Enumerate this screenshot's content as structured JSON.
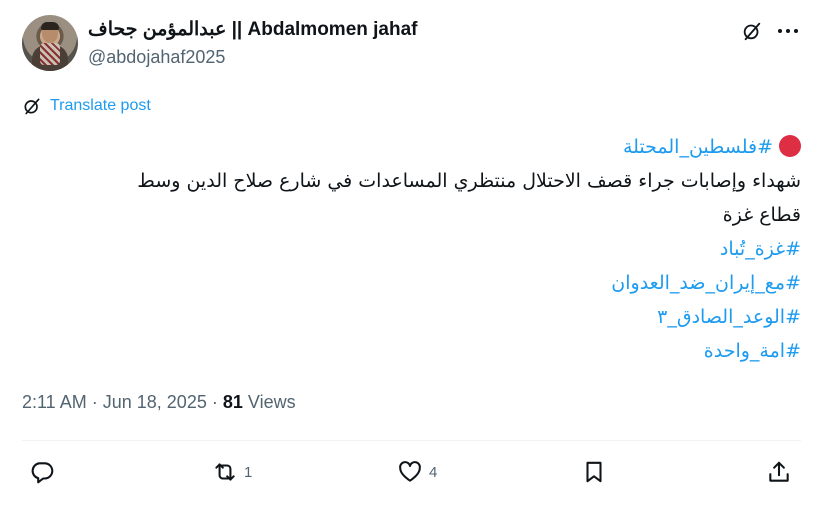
{
  "author": {
    "display_name": "عبدالمؤمن جحاف || Abdalmomen jahaf",
    "handle": "@abdojahaf2025"
  },
  "translate": {
    "label": "Translate post"
  },
  "tweet": {
    "lines": [
      {
        "text": "#فلسطين_المحتلة",
        "kind": "hashtag",
        "prefix": "red-circle"
      },
      {
        "text": "شهداء وإصابات جراء قصف الاحتلال منتظري المساعدات في شارع صلاح الدين وسط",
        "kind": "text"
      },
      {
        "text": "قطاع غزة",
        "kind": "text"
      },
      {
        "text": "#غزة_تُباد",
        "kind": "hashtag"
      },
      {
        "text": "#مع_إيران_ضد_العدوان",
        "kind": "hashtag"
      },
      {
        "text": "#الوعد_الصادق_٣",
        "kind": "hashtag"
      },
      {
        "text": "#امة_واحدة",
        "kind": "hashtag"
      }
    ]
  },
  "meta": {
    "time": "2:11 AM",
    "date": "Jun 18, 2025",
    "separator": "·",
    "views_count": "81",
    "views_label": "Views"
  },
  "actions": {
    "reply_count": "",
    "retweet_count": "1",
    "like_count": "4"
  },
  "colors": {
    "accent": "#1d9bf0",
    "text": "#0f1419",
    "secondary": "#536471",
    "red_circle": "#dd2e44"
  },
  "icons": {
    "grok": "grok-icon",
    "more": "more-icon",
    "translate": "grok-icon",
    "reply": "reply-icon",
    "retweet": "retweet-icon",
    "like": "heart-icon",
    "bookmark": "bookmark-icon",
    "share": "share-icon"
  }
}
